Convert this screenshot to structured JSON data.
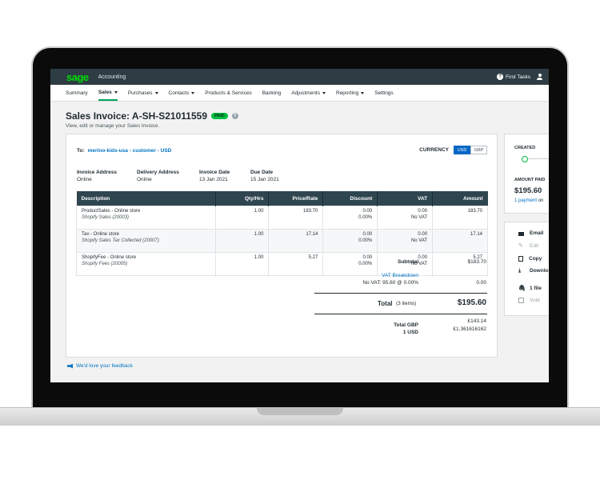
{
  "topbar": {
    "logo": "sage",
    "product": "Accounting",
    "first_tasks": "First Tasks"
  },
  "nav": [
    {
      "label": "Summary",
      "caret": false,
      "active": false
    },
    {
      "label": "Sales",
      "caret": true,
      "active": true
    },
    {
      "label": "Purchases",
      "caret": true,
      "active": false
    },
    {
      "label": "Contacts",
      "caret": true,
      "active": false
    },
    {
      "label": "Products & Services",
      "caret": false,
      "active": false
    },
    {
      "label": "Banking",
      "caret": false,
      "active": false
    },
    {
      "label": "Adjustments",
      "caret": true,
      "active": false
    },
    {
      "label": "Reporting",
      "caret": true,
      "active": false
    },
    {
      "label": "Settings",
      "caret": false,
      "active": false
    }
  ],
  "page": {
    "title": "Sales Invoice: A-SH-S21011559",
    "badge": "PAID",
    "subtitle": "View, edit or manage your Sales Invoice."
  },
  "invoice": {
    "to_label": "To:",
    "customer": "merino-kids-usa - customer - USD",
    "currency_label": "CURRENCY",
    "currency_options": [
      "USD",
      "GBP"
    ],
    "selected_currency": "USD",
    "invoice_address_label": "Invoice Address",
    "invoice_address": "Online",
    "delivery_address_label": "Delivery Address",
    "delivery_address": "Online",
    "invoice_date_label": "Invoice Date",
    "invoice_date": "13 Jan 2021",
    "due_date_label": "Due Date",
    "due_date": "15 Jan 2021"
  },
  "table": {
    "headers": [
      "Description",
      "Qty/Hrs",
      "Price/Rate",
      "Discount",
      "VAT",
      "Amount"
    ],
    "rows": [
      {
        "desc": "ProductSales - Online store",
        "account": "Shopify Sales (20003)",
        "qty": "1.00",
        "price": "183.70",
        "discount": "0.00",
        "discount_pct": "0.00%",
        "vat": "0.00",
        "vat_rate": "No VAT",
        "amount": "183.70"
      },
      {
        "desc": "Tax - Online store",
        "account": "Shopify Sales Tax Collected (20007)",
        "qty": "1.00",
        "price": "17.14",
        "discount": "0.00",
        "discount_pct": "0.00%",
        "vat": "0.00",
        "vat_rate": "No VAT",
        "amount": "17.14"
      },
      {
        "desc": "ShopifyFee - Online store",
        "account": "Shopify Fees (20005)",
        "qty": "1.00",
        "price": "5.27",
        "discount": "0.00",
        "discount_pct": "0.00%",
        "vat": "0.00",
        "vat_rate": "No VAT",
        "amount": "5.27"
      }
    ]
  },
  "totals": {
    "subtotal_label": "Subtotal",
    "subtotal": "$183.70",
    "vat_breakdown_label": "VAT Breakdown",
    "vat_detail": "No VAT: 95.60 @ 0.00%",
    "vat_amount": "0.00",
    "total_label": "Total",
    "total_items": "(3 items)",
    "total": "$195.60",
    "total_gbp_label": "Total GBP",
    "total_gbp": "£143.14",
    "rate_label": "1 USD",
    "rate": "£1.361616162"
  },
  "side": {
    "created_label": "CREATED",
    "amount_paid_label": "AMOUNT PAID",
    "amount_paid": "$195.60",
    "payment_link": "1 payment",
    "payment_rest": "on",
    "actions": {
      "email": "Email",
      "edit": "Edit",
      "copy": "Copy",
      "download": "Downlo",
      "files": "1 file",
      "void": "Void"
    }
  },
  "feedback": "We'd love your feedback",
  "colors": {
    "brand_green": "#00dc06",
    "header_bg": "#2e3d44",
    "table_header": "#2f4650",
    "link": "#0073c2",
    "paid": "#00c043"
  }
}
